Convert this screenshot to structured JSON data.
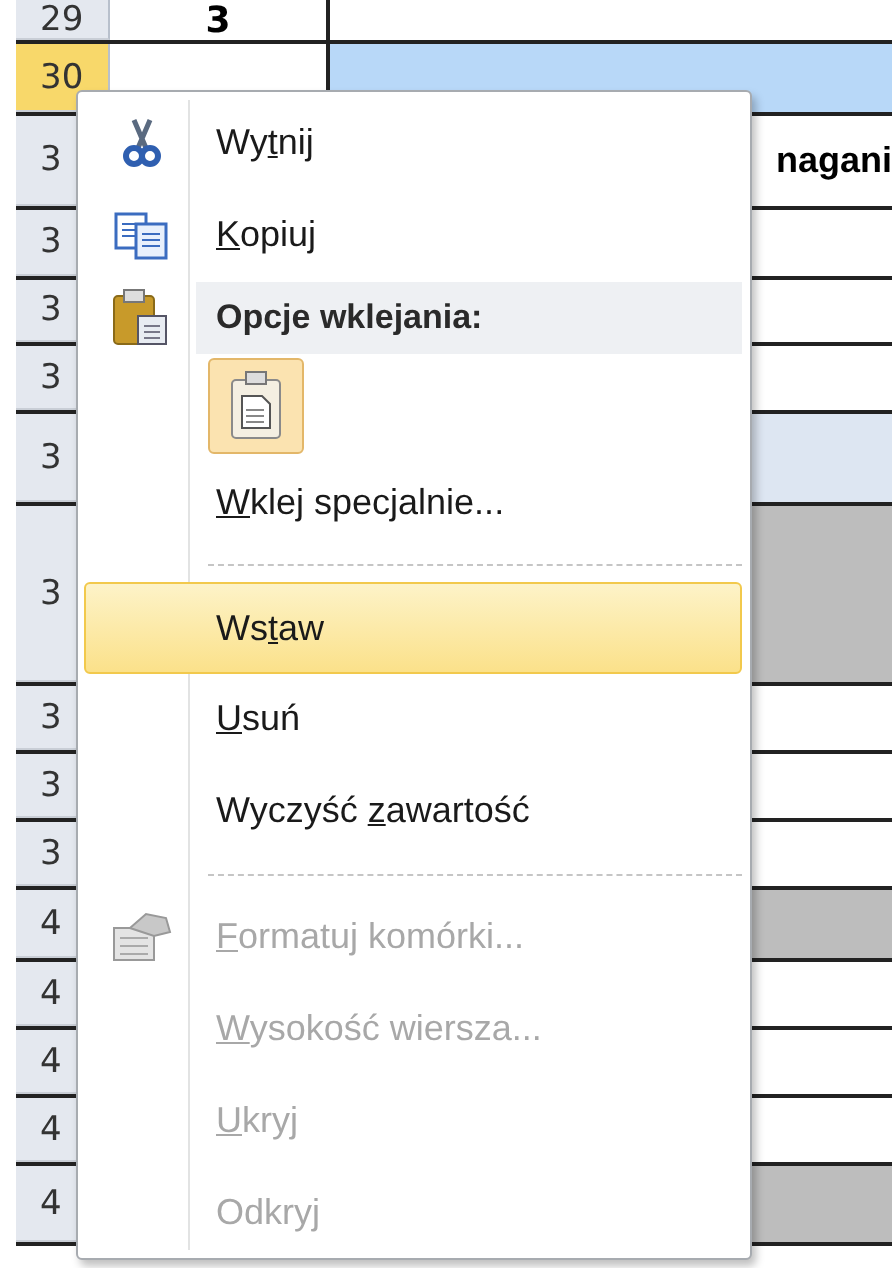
{
  "sheet": {
    "rows": [
      {
        "number": "29",
        "selected": false,
        "kind": "plain",
        "cell_b": "3"
      },
      {
        "number": "30",
        "selected": true,
        "kind": "selected"
      },
      {
        "number": "3",
        "selected": false,
        "kind": "plain",
        "cell_c": "nagani"
      },
      {
        "number": "3",
        "selected": false,
        "kind": "plain"
      },
      {
        "number": "3",
        "selected": false,
        "kind": "plain"
      },
      {
        "number": "3",
        "selected": false,
        "kind": "plain"
      },
      {
        "number": "3",
        "selected": false,
        "kind": "tinted"
      },
      {
        "number": "3",
        "selected": false,
        "kind": "shaded"
      },
      {
        "number": "3",
        "selected": false,
        "kind": "plain"
      },
      {
        "number": "3",
        "selected": false,
        "kind": "plain"
      },
      {
        "number": "3",
        "selected": false,
        "kind": "plain"
      },
      {
        "number": "4",
        "selected": false,
        "kind": "shaded"
      },
      {
        "number": "4",
        "selected": false,
        "kind": "plain"
      },
      {
        "number": "4",
        "selected": false,
        "kind": "plain"
      },
      {
        "number": "4",
        "selected": false,
        "kind": "plain"
      },
      {
        "number": "4",
        "selected": false,
        "kind": "shaded"
      }
    ]
  },
  "context_menu": {
    "items": [
      {
        "kind": "item",
        "label": "Wytnij",
        "selected": false,
        "disabled": false
      },
      {
        "kind": "item",
        "label": "Kopiuj",
        "selected": false,
        "disabled": false
      },
      {
        "kind": "header",
        "label": "Opcje wklejania:"
      },
      {
        "kind": "paste-options"
      },
      {
        "kind": "item",
        "label": "Wklej specjalnie...",
        "selected": false,
        "disabled": false
      },
      {
        "kind": "separator"
      },
      {
        "kind": "item",
        "label": "Wstaw",
        "selected": true,
        "disabled": false
      },
      {
        "kind": "item",
        "label": "Usuń",
        "selected": false,
        "disabled": false
      },
      {
        "kind": "item",
        "label": "Wyczyść zawartość",
        "selected": false,
        "disabled": false
      },
      {
        "kind": "separator"
      },
      {
        "kind": "item",
        "label": "Formatuj komórki...",
        "selected": false,
        "disabled": true
      },
      {
        "kind": "item",
        "label": "Wysokość wiersza...",
        "selected": false,
        "disabled": true
      },
      {
        "kind": "item",
        "label": "Ukryj",
        "selected": false,
        "disabled": true
      },
      {
        "kind": "item",
        "label": "Odkryj",
        "selected": false,
        "disabled": true
      }
    ]
  }
}
